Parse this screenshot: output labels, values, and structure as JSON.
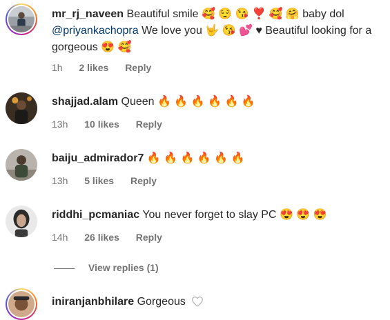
{
  "comments": [
    {
      "username": "mr_rj_naveen",
      "text_1": "Beautiful smile 🥰 😌 😘 ❣️ 🥰 🤗 baby dol",
      "mention": "@priyankachopra",
      "text_2": "We love you 🤟 😘 💕 ♥ Beautiful looking for a gorgeous 😍 🥰",
      "time": "1h",
      "likes": "2 likes",
      "reply": "Reply"
    },
    {
      "username": "shajjad.alam",
      "text": "Queen 🔥 🔥 🔥 🔥 🔥 🔥",
      "time": "13h",
      "likes": "10 likes",
      "reply": "Reply"
    },
    {
      "username": "baiju_admirador7",
      "text": "🔥 🔥 🔥 🔥 🔥 🔥",
      "time": "13h",
      "likes": "5 likes",
      "reply": "Reply"
    },
    {
      "username": "riddhi_pcmaniac",
      "text": "You never forget to slay PC 😍 😍 😍",
      "time": "14h",
      "likes": "26 likes",
      "reply": "Reply"
    },
    {
      "username": "iniranjanbhilare",
      "text": "Gorgeous"
    }
  ],
  "view_replies": "View replies (1)",
  "icons": {
    "like": "heart-outline-icon"
  }
}
